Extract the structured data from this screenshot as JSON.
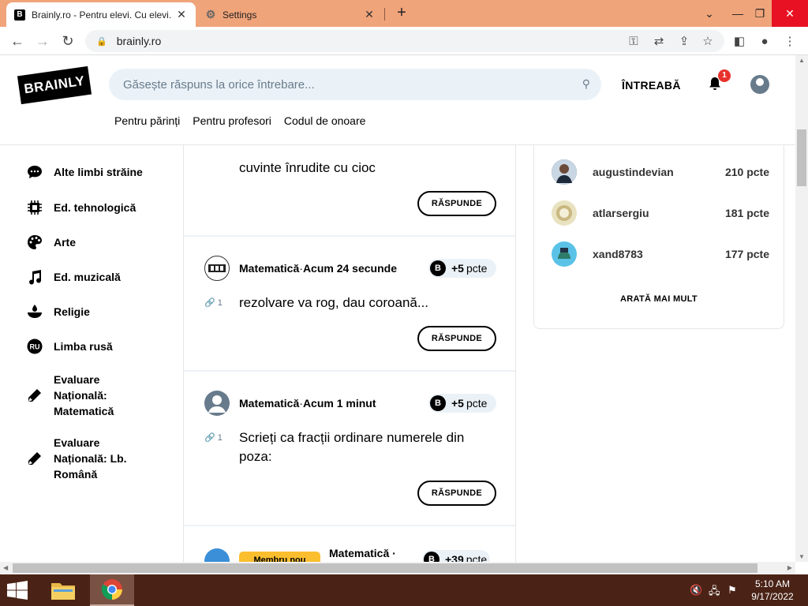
{
  "browser": {
    "tabs": [
      {
        "title": "Brainly.ro - Pentru elevi. Cu elevi.",
        "favicon": "B",
        "active": true
      },
      {
        "title": "Settings",
        "favicon": "⚙",
        "active": false
      }
    ],
    "url": "brainly.ro"
  },
  "header": {
    "logo_text": "BRAINLY",
    "search_placeholder": "Găsește răspuns la orice întrebare...",
    "ask_label": "ÎNTREABĂ",
    "notification_count": "1",
    "links": [
      "Pentru părinți",
      "Pentru profesori",
      "Codul de onoare"
    ]
  },
  "sidebar": {
    "items": [
      {
        "label": "Alte limbi străine",
        "icon": "chat-bubble-icon"
      },
      {
        "label": "Ed. tehnologică",
        "icon": "chip-icon"
      },
      {
        "label": "Arte",
        "icon": "palette-icon"
      },
      {
        "label": "Ed. muzicală",
        "icon": "music-note-icon"
      },
      {
        "label": "Religie",
        "icon": "candle-icon"
      },
      {
        "label": "Limba rusă",
        "icon": "ru-badge-icon"
      },
      {
        "label": "Evaluare Națională: Matematică",
        "icon": "pencil-icon"
      },
      {
        "label": "Evaluare Națională: Lb. Română",
        "icon": "pencil-icon"
      }
    ]
  },
  "feed": {
    "answer_label": "RĂSPUNDE",
    "points_unit": "pcte",
    "questions": [
      {
        "text": "cuvinte înrudite cu cioc"
      },
      {
        "subject": "Matematică",
        "separator": "·",
        "time": "Acum 24 secunde",
        "points": "+5",
        "attachments": "1",
        "text": "rezolvare va rog, dau coroană..."
      },
      {
        "subject": "Matematică",
        "separator": "·",
        "time": "Acum 1 minut",
        "points": "+5",
        "attachments": "1",
        "text": "Scrieți ca fracții ordinare numerele din poza:"
      },
      {
        "subject": "Matematică ·",
        "badge": "Membru nou",
        "points": "+39"
      }
    ]
  },
  "leaderboard": {
    "users": [
      {
        "name": "augustindevian",
        "points": "210 pcte"
      },
      {
        "name": "atlarsergiu",
        "points": "181 pcte"
      },
      {
        "name": "xand8783",
        "points": "177 pcte"
      }
    ],
    "show_more": "ARATĂ MAI MULT"
  },
  "taskbar": {
    "time": "5:10 AM",
    "date": "9/17/2022"
  },
  "colors": {
    "titlebar": "#f0a47a",
    "taskbar": "#4a2316",
    "search_bg": "#ebf2f7",
    "badge_red": "#e8322d",
    "new_member_yellow": "#fbbe2e"
  }
}
